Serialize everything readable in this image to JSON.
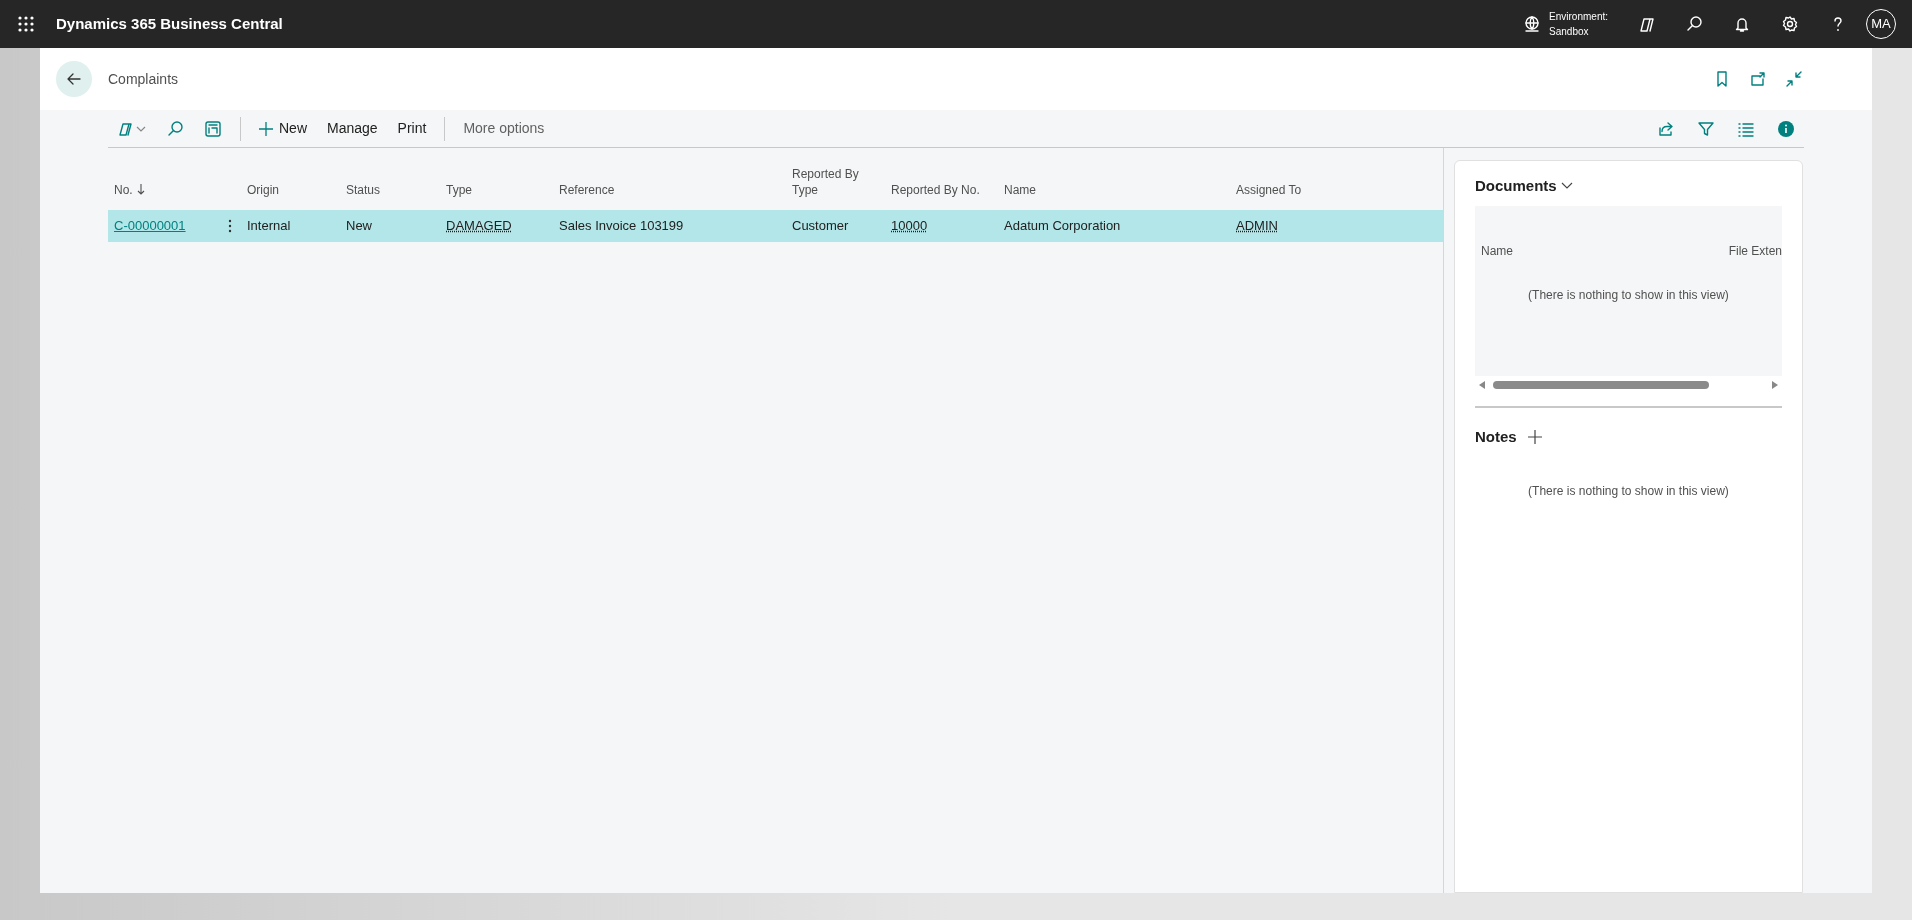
{
  "app_bar": {
    "title": "Dynamics 365 Business Central",
    "environment_label": "Environment:",
    "environment_name": "Sandbox",
    "avatar": "MA"
  },
  "page": {
    "title": "Complaints"
  },
  "toolbar": {
    "actions": [
      {
        "label": "New",
        "kind": "new"
      },
      {
        "label": "Manage",
        "kind": "plain"
      },
      {
        "label": "Print",
        "kind": "plain"
      }
    ],
    "more": "More options"
  },
  "table": {
    "columns": [
      {
        "label": "No.",
        "sorted": true
      },
      {
        "label": "Origin",
        "sorted": false
      },
      {
        "label": "Status",
        "sorted": false
      },
      {
        "label": "Type",
        "sorted": false
      },
      {
        "label": "Reference",
        "sorted": false
      },
      {
        "label": "Reported By Type",
        "sorted": false
      },
      {
        "label": "Reported By No.",
        "sorted": false
      },
      {
        "label": "Name",
        "sorted": false
      },
      {
        "label": "Assigned To",
        "sorted": false
      }
    ],
    "rows": [
      {
        "selected": true,
        "cells": [
          {
            "text": "C-00000001",
            "kind": "link"
          },
          {
            "text": "Internal",
            "kind": "text"
          },
          {
            "text": "New",
            "kind": "text"
          },
          {
            "text": "DAMAGED",
            "kind": "lookup"
          },
          {
            "text": "Sales Invoice 103199",
            "kind": "text"
          },
          {
            "text": "Customer",
            "kind": "text"
          },
          {
            "text": "10000",
            "kind": "lookup"
          },
          {
            "text": "Adatum Corporation",
            "kind": "text"
          },
          {
            "text": "ADMIN",
            "kind": "lookup"
          }
        ]
      }
    ]
  },
  "factbox": {
    "documents": {
      "title": "Documents",
      "columns": [
        "Name",
        "File Exten"
      ],
      "empty": "(There is nothing to show in this view)"
    },
    "notes": {
      "title": "Notes",
      "empty": "(There is nothing to show in this view)"
    }
  }
}
